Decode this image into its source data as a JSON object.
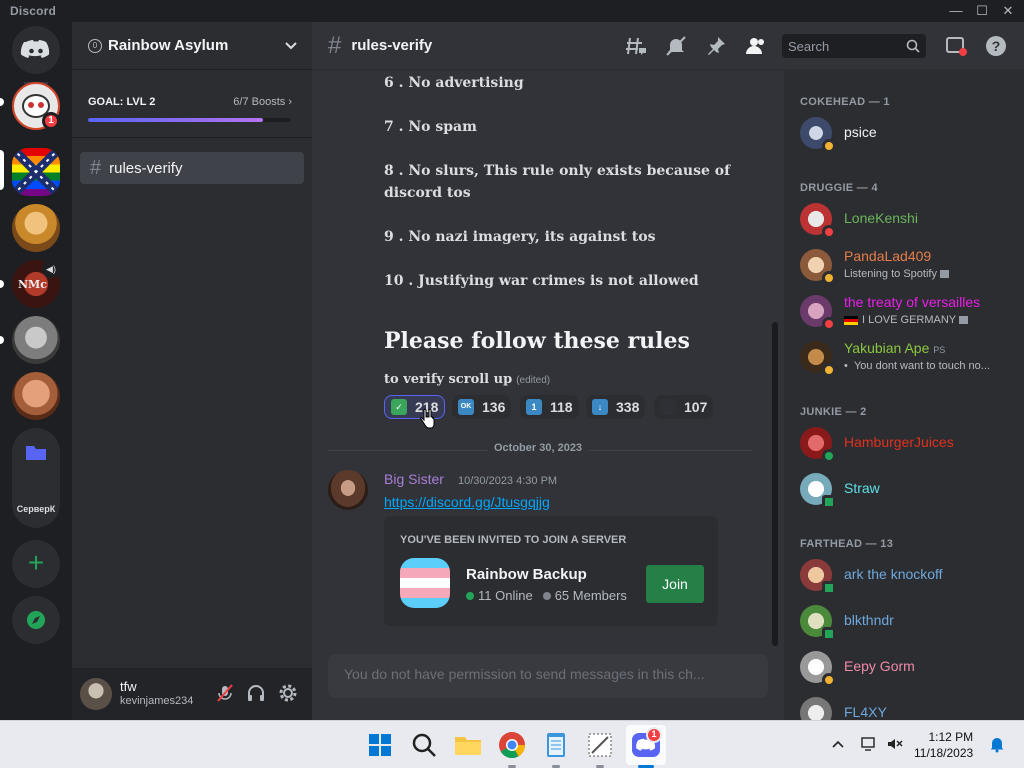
{
  "app_title": "Discord",
  "server_list": {
    "badge_count": "1",
    "folder_label": "СерверК"
  },
  "guild": {
    "name": "Rainbow Asylum",
    "boost_level": "0",
    "goal_label": "GOAL: LVL 2",
    "boosts": "6/7 Boosts",
    "boost_progress": 0.86
  },
  "channel": {
    "name": "rules-verify"
  },
  "header": {
    "search_placeholder": "Search"
  },
  "rules": [
    "6 . No advertising",
    "7 . No spam",
    "8 . No slurs, This rule only exists because of discord tos",
    "9 . No nazi imagery, its against tos",
    "10 . Justifying war crimes is not allowed"
  ],
  "rules_heading": "Please follow these rules",
  "rules_sub": "to verify scroll up",
  "edited_label": "(edited)",
  "reactions": [
    {
      "emoji": "check",
      "label": "✓",
      "count": "218",
      "color": "#3ba55c"
    },
    {
      "emoji": "ok",
      "label": "OK",
      "count": "136",
      "color": "#3b88c3"
    },
    {
      "emoji": "one",
      "label": "1",
      "count": "118",
      "color": "#3b88c3"
    },
    {
      "emoji": "down-arrow",
      "label": "↓",
      "count": "338",
      "color": "#3b88c3"
    },
    {
      "emoji": "blank",
      "label": "",
      "count": "107",
      "color": "#2b2d31"
    }
  ],
  "date_divider": "October 30, 2023",
  "message": {
    "author": "Big Sister",
    "timestamp": "10/30/2023 4:30 PM",
    "link": "https://discord.gg/Jtusgqjjg"
  },
  "invite": {
    "heading": "YOU'VE BEEN INVITED TO JOIN A SERVER",
    "server_name": "Rainbow Backup",
    "online": "11 Online",
    "members": "65 Members",
    "join_label": "Join"
  },
  "composer_placeholder": "You do not have permission to send messages in this ch...",
  "user": {
    "display": "tfw",
    "tag": "kevinjames234"
  },
  "member_groups": [
    {
      "title": "COKEHEAD — 1",
      "members": [
        {
          "name": "psice",
          "color": "#f2f3f5",
          "status": "idle"
        }
      ]
    },
    {
      "title": "DRUGGIE — 4",
      "members": [
        {
          "name": "LoneKenshi",
          "color": "#6bb55c",
          "status": "dnd"
        },
        {
          "name": "PandaLad409",
          "color": "#e67e4a",
          "status": "idle",
          "activity": "Listening to Spotify"
        },
        {
          "name": "the treaty of versailles",
          "color": "#e91ee8",
          "status": "dnd",
          "activity": "I LOVE GERMANY"
        },
        {
          "name": "Yakubian Ape",
          "color": "#8cc63f",
          "status": "idle",
          "tag": "PS",
          "activity": "You dont want to touch no..."
        }
      ]
    },
    {
      "title": "JUNKIE — 2",
      "members": [
        {
          "name": "HamburgerJuices",
          "color": "#e0301e",
          "status": "online"
        },
        {
          "name": "Straw",
          "color": "#5de0e6",
          "status": "mobile"
        }
      ]
    },
    {
      "title": "FARTHEAD — 13",
      "members": [
        {
          "name": "ark the knockoff",
          "color": "#6fa8dc",
          "status": "mobile"
        },
        {
          "name": "blkthndr",
          "color": "#6fa8dc",
          "status": "mobile"
        },
        {
          "name": "Eepy Gorm",
          "color": "#f08aa8",
          "status": "idle"
        },
        {
          "name": "FL4XY",
          "color": "#6fa8dc",
          "status": "online"
        }
      ]
    }
  ],
  "taskbar": {
    "discord_badge": "1",
    "time": "1:12 PM",
    "date": "11/18/2023"
  }
}
